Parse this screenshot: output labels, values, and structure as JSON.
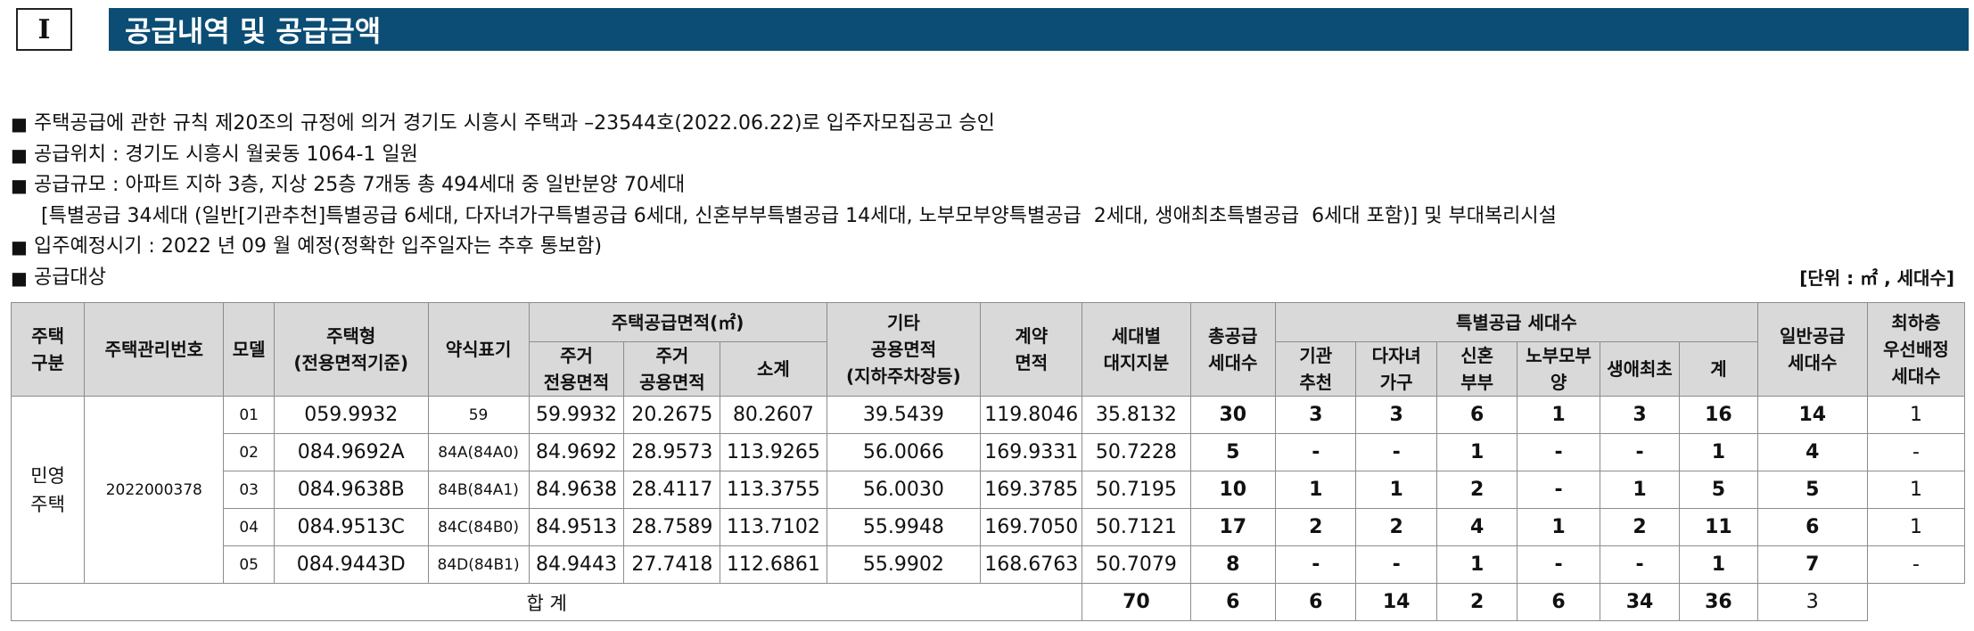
{
  "header": {
    "roman_numeral": "Ⅰ",
    "title": "공급내역 및 공급금액"
  },
  "bullets": {
    "b1": "주택공급에 관한 규칙 제20조의 규정에 의거 경기도 시흥시 주택과 –23544호(2022.06.22)로 입주자모집공고 승인",
    "b2": "공급위치 : 경기도 시흥시 월곶동 1064-1 일원",
    "b3": "공급규모 : 아파트 지하 3층, 지상 25층 7개동 총 494세대 중 일반분양 70세대",
    "b3_cont": "[특별공급 34세대 (일반[기관추천]특별공급 6세대, 다자녀가구특별공급 6세대, 신혼부부특별공급 14세대, 노부모부양특별공급  2세대, 생애최초특별공급  6세대 포함)] 및 부대복리시설",
    "b4": "입주예정시기 : 2022 년 09 월 예정(정확한 입주일자는 추후 통보함)",
    "b5": "공급대상",
    "bullet_mark": "■",
    "unit": "[단위 : ㎡ , 세대수]"
  },
  "table": {
    "headers": {
      "housing_type": "주택\n구분",
      "mgmt_no": "주택관리번호",
      "model": "모델",
      "house_type": "주택형\n(전용면적기준)",
      "short": "약식표기",
      "area_group": "주택공급면적(㎡)",
      "area_private": "주거\n전용면적",
      "area_common": "주거\n공용면적",
      "area_subtotal": "소계",
      "other_common": "기타\n공용면적\n(지하주차장등)",
      "contract_area": "계약\n면적",
      "land_share": "세대별\n대지지분",
      "total_supply": "총공급\n세대수",
      "special_group": "특별공급 세대수",
      "sp_agency": "기관\n추천",
      "sp_multichild": "다자녀\n가구",
      "sp_newlywed": "신혼\n부부",
      "sp_parents": "노부모부\n양",
      "sp_firsttime": "생애최초",
      "sp_total": "계",
      "general_supply": "일반공급\n세대수",
      "lowest_floor": "최하층\n우선배정\n세대수"
    },
    "housing_type_value": "민영\n주택",
    "mgmt_no_value": "2022000378",
    "rows": [
      {
        "model": "01",
        "house_type": "059.9932",
        "short": "59",
        "private": "59.9932",
        "common": "20.2675",
        "subtotal": "80.2607",
        "other": "39.5439",
        "contract": "119.8046",
        "land": "35.8132",
        "total": "30",
        "agency": "3",
        "multichild": "3",
        "newlywed": "6",
        "parents": "1",
        "firsttime": "3",
        "sp_sum": "16",
        "general": "14",
        "lowest": "1"
      },
      {
        "model": "02",
        "house_type": "084.9692A",
        "short": "84A(84A0)",
        "private": "84.9692",
        "common": "28.9573",
        "subtotal": "113.9265",
        "other": "56.0066",
        "contract": "169.9331",
        "land": "50.7228",
        "total": "5",
        "agency": "-",
        "multichild": "-",
        "newlywed": "1",
        "parents": "-",
        "firsttime": "-",
        "sp_sum": "1",
        "general": "4",
        "lowest": "-"
      },
      {
        "model": "03",
        "house_type": "084.9638B",
        "short": "84B(84A1)",
        "private": "84.9638",
        "common": "28.4117",
        "subtotal": "113.3755",
        "other": "56.0030",
        "contract": "169.3785",
        "land": "50.7195",
        "total": "10",
        "agency": "1",
        "multichild": "1",
        "newlywed": "2",
        "parents": "-",
        "firsttime": "1",
        "sp_sum": "5",
        "general": "5",
        "lowest": "1"
      },
      {
        "model": "04",
        "house_type": "084.9513C",
        "short": "84C(84B0)",
        "private": "84.9513",
        "common": "28.7589",
        "subtotal": "113.7102",
        "other": "55.9948",
        "contract": "169.7050",
        "land": "50.7121",
        "total": "17",
        "agency": "2",
        "multichild": "2",
        "newlywed": "4",
        "parents": "1",
        "firsttime": "2",
        "sp_sum": "11",
        "general": "6",
        "lowest": "1"
      },
      {
        "model": "05",
        "house_type": "084.9443D",
        "short": "84D(84B1)",
        "private": "84.9443",
        "common": "27.7418",
        "subtotal": "112.6861",
        "other": "55.9902",
        "contract": "168.6763",
        "land": "50.7079",
        "total": "8",
        "agency": "-",
        "multichild": "-",
        "newlywed": "1",
        "parents": "-",
        "firsttime": "-",
        "sp_sum": "1",
        "general": "7",
        "lowest": "-"
      }
    ],
    "totals": {
      "label": "합 계",
      "total": "70",
      "agency": "6",
      "multichild": "6",
      "newlywed": "14",
      "parents": "2",
      "firsttime": "6",
      "sp_sum": "34",
      "general": "36",
      "lowest": "3"
    }
  },
  "colors": {
    "title_bar": "#0b4d74",
    "header_bg": "#d9d9d9",
    "border": "#8c8c8c"
  }
}
